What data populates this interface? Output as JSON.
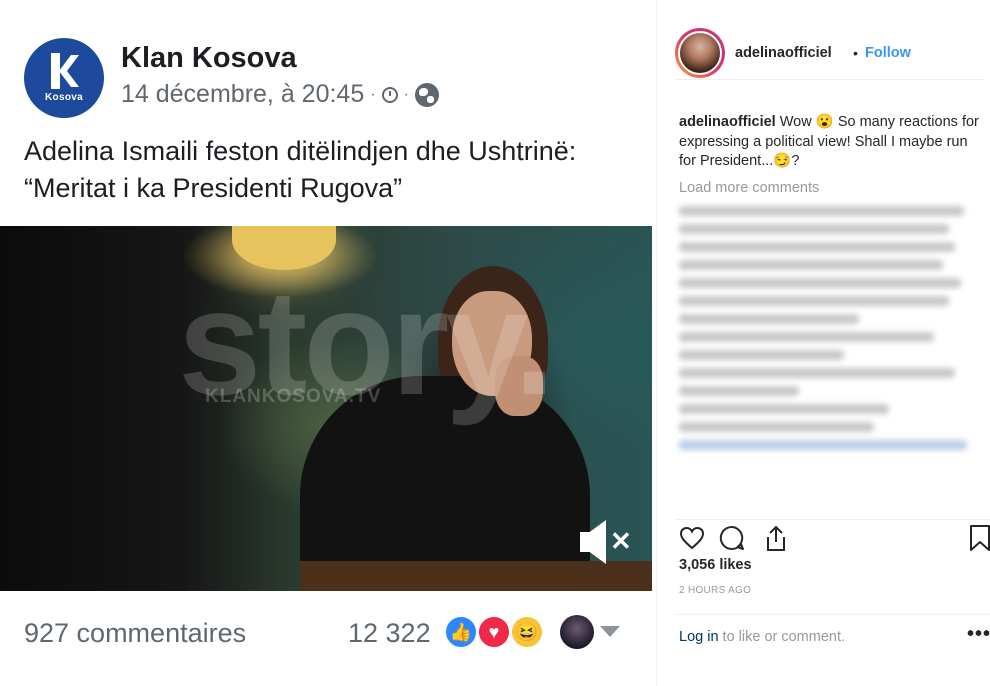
{
  "facebook": {
    "page_name": "Klan Kosova",
    "logo_text": "Kosova",
    "timestamp": "14 décembre, à 20:45",
    "meta_separator": "·",
    "headline": "Adelina Ismaili feston ditëlindjen dhe Ushtrinë: “Meritat i ka Presidenti Rugova”",
    "video": {
      "watermark": "story.",
      "watermark_small": "KLANKOSOVA.TV",
      "muted": true
    },
    "comments_count": "927 commentaires",
    "reactions_count": "12 322",
    "reaction_types": [
      "like-icon",
      "love-icon",
      "haha-icon"
    ],
    "colors": {
      "brand": "#1d4a9c",
      "like": "#2d88ff",
      "love": "#f0284a",
      "haha": "#f7c339"
    }
  },
  "instagram": {
    "username": "adelinaofficiel",
    "separator": "•",
    "follow_label": "Follow",
    "caption_user": "adelinaofficiel",
    "caption_text_1": " Wow ",
    "caption_emoji_1": "😮",
    "caption_text_2": " So many reactions for expressing a political view! Shall I maybe run for President...",
    "caption_emoji_2": "😏",
    "caption_text_3": "?",
    "load_more": "Load more comments",
    "likes": "3,056 likes",
    "time_ago": "2 HOURS AGO",
    "login_link": "Log in",
    "login_text": " to like or comment.",
    "more_label": "•••",
    "colors": {
      "link": "#3897f0",
      "login_link": "#003569"
    }
  }
}
